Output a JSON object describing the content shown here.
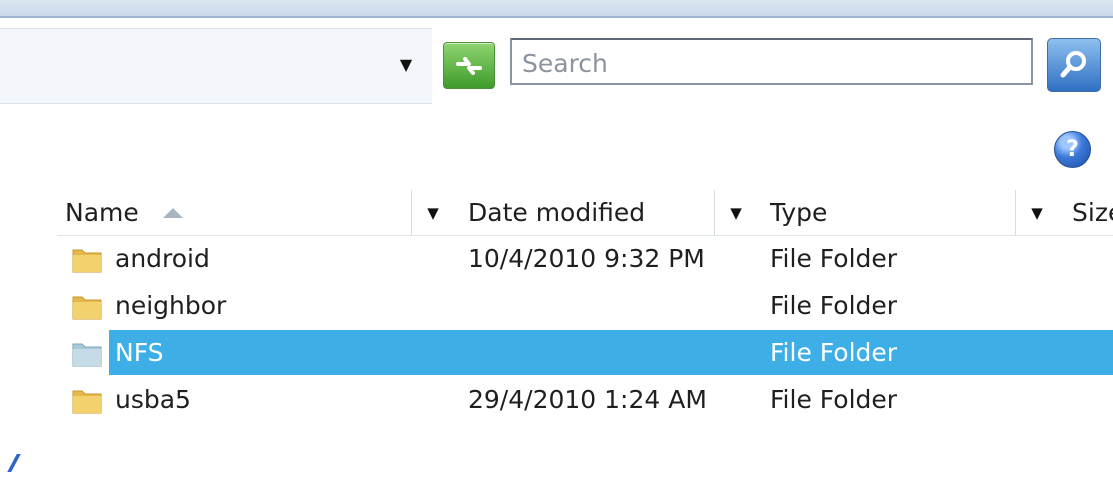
{
  "toolbar": {
    "search_placeholder": "Search",
    "icons": {
      "dropdown": "dropdown-arrow-icon",
      "refresh": "refresh-icon",
      "search": "magnifier-icon",
      "help": "help-icon"
    }
  },
  "columns": [
    {
      "label": "Name"
    },
    {
      "label": "Date modified"
    },
    {
      "label": "Type"
    },
    {
      "label": "Size"
    }
  ],
  "files": [
    {
      "name": "android",
      "date": "10/4/2010 9:32 PM",
      "type": "File Folder",
      "selected": false
    },
    {
      "name": "neighbor",
      "date": "",
      "type": "File Folder",
      "selected": false
    },
    {
      "name": "NFS",
      "date": "",
      "type": "File Folder",
      "selected": true
    },
    {
      "name": "usba5",
      "date": "29/4/2010 1:24 AM",
      "type": "File Folder",
      "selected": false
    }
  ],
  "colors": {
    "selection": "#3daee6",
    "folder": "#e6b84b",
    "selected_folder": "#a9c8d8"
  }
}
